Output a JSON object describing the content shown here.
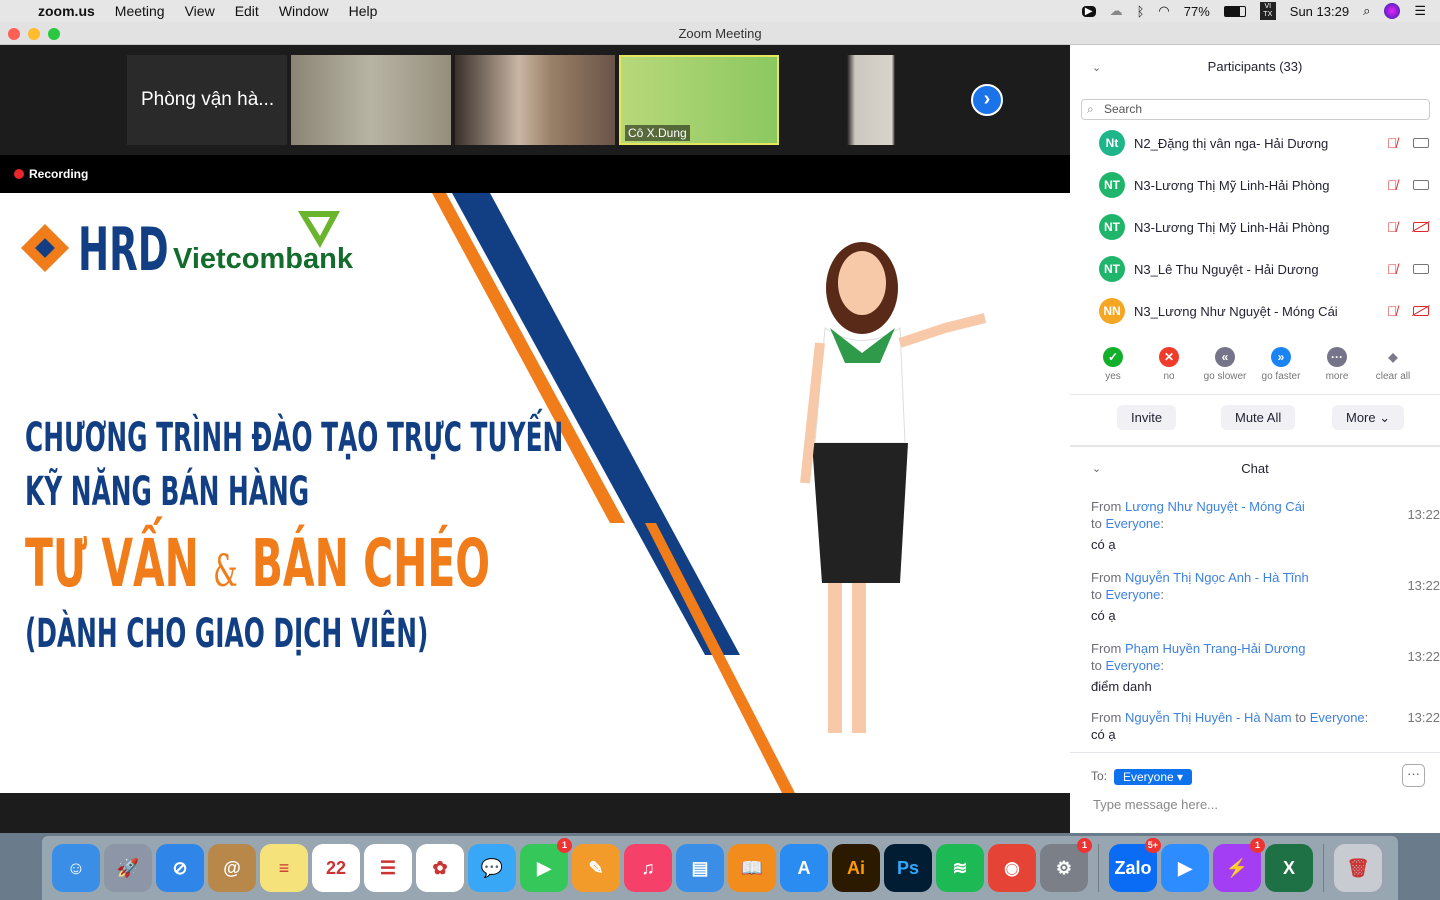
{
  "menubar": {
    "app": "zoom.us",
    "items": [
      "Meeting",
      "View",
      "Edit",
      "Window",
      "Help"
    ],
    "battery": "77%",
    "input": "VI TX",
    "clock": "Sun 13:29"
  },
  "window": {
    "title": "Zoom Meeting"
  },
  "thumbnails": {
    "first_label": "Phòng vận hà...",
    "active_name": "Cô X.Dung"
  },
  "recording": "Recording",
  "slide": {
    "logo_hrd": "HRD",
    "logo_bank": "Vietcombank",
    "line1": "CHƯƠNG TRÌNH ĐÀO TẠO TRỰC TUYẾN",
    "line2": "KỸ NĂNG BÁN HÀNG",
    "line3a": "TƯ VẤN",
    "amp": "&",
    "line3b": "BÁN CHÉO",
    "line4": "(DÀNH CHO GIAO DỊCH VIÊN)"
  },
  "participants": {
    "title": "Participants (33)",
    "search_placeholder": "Search",
    "list": [
      {
        "initials": "Nt",
        "name": "N2_Đặng thị vân nga- Hải Dương",
        "color": "#1fb58a",
        "video_off": false
      },
      {
        "initials": "NT",
        "name": "N3-Lương Thị Mỹ Linh-Hải Phòng",
        "color": "#1fb56a",
        "video_off": false
      },
      {
        "initials": "NT",
        "name": "N3-Lương Thị Mỹ Linh-Hải Phòng",
        "color": "#1fb56a",
        "video_off": true
      },
      {
        "initials": "NT",
        "name": "N3_Lê Thu Nguyệt - Hải Dương",
        "color": "#1fb56a",
        "video_off": false
      },
      {
        "initials": "NN",
        "name": "N3_Lương Như Nguyệt - Móng Cái",
        "color": "#f5a623",
        "video_off": true
      }
    ],
    "reactions": [
      {
        "label": "yes",
        "glyph": "✓",
        "color": "#12b02a"
      },
      {
        "label": "no",
        "glyph": "✕",
        "color": "#f03a2a"
      },
      {
        "label": "go slower",
        "glyph": "«",
        "color": "#76748a"
      },
      {
        "label": "go faster",
        "glyph": "»",
        "color": "#1a84f5"
      },
      {
        "label": "more",
        "glyph": "···",
        "color": "#76748a"
      },
      {
        "label": "clear all",
        "glyph": "◆",
        "color": "#7a7a8a"
      }
    ],
    "invite": "Invite",
    "mute_all": "Mute All",
    "more": "More ⌄"
  },
  "chat": {
    "title": "Chat",
    "messages": [
      {
        "from": "Lương Như Nguyệt - Móng Cái",
        "to": "Everyone",
        "time": "13:22",
        "text": "có ạ"
      },
      {
        "from": "Nguyễn Thị Ngọc Anh -  Hà Tĩnh",
        "to": "Everyone",
        "time": "13:22",
        "text": "có ạ"
      },
      {
        "from": "Phạm Huyền Trang-Hải Dương",
        "to": "Everyone",
        "time": "13:22",
        "text": "điểm danh"
      },
      {
        "from": "Nguyễn Thị Huyên - Hà Nam",
        "to": "Everyone",
        "time": "13:22",
        "text": "có ạ"
      }
    ],
    "from_word": "From",
    "to_word": "to",
    "to_label": "To:",
    "recipient": "Everyone ▾",
    "placeholder": "Type message here..."
  },
  "dock": [
    {
      "name": "Finder",
      "label": "☺",
      "color": "#3a8ee6"
    },
    {
      "name": "Launchpad",
      "label": "🚀",
      "color": "#8c96a6"
    },
    {
      "name": "Safari",
      "label": "⊘",
      "color": "#2f86e8"
    },
    {
      "name": "Contacts",
      "label": "@",
      "color": "#b8874a"
    },
    {
      "name": "Notes",
      "label": "≡",
      "color": "#f6e27a"
    },
    {
      "name": "Calendar",
      "label": "22",
      "color": "#ffffff"
    },
    {
      "name": "Reminders",
      "label": "☰",
      "color": "#ffffff"
    },
    {
      "name": "Photos",
      "label": "✿",
      "color": "#ffffff"
    },
    {
      "name": "Messages",
      "label": "💬",
      "color": "#38a7f5"
    },
    {
      "name": "FaceTime",
      "label": "▶",
      "color": "#35c759",
      "badge": "1"
    },
    {
      "name": "Pages",
      "label": "✎",
      "color": "#f29b2b"
    },
    {
      "name": "Music",
      "label": "♫",
      "color": "#f5406a"
    },
    {
      "name": "Keynote",
      "label": "▤",
      "color": "#3a8ee6"
    },
    {
      "name": "Books",
      "label": "📖",
      "color": "#f28c1c"
    },
    {
      "name": "App Store",
      "label": "A",
      "color": "#2a8cf0"
    },
    {
      "name": "Illustrator",
      "label": "Ai",
      "color": "#2b1a00"
    },
    {
      "name": "Photoshop",
      "label": "Ps",
      "color": "#001d34"
    },
    {
      "name": "Spotify",
      "label": "≋",
      "color": "#1db954"
    },
    {
      "name": "Chrome",
      "label": "◉",
      "color": "#e54335"
    },
    {
      "name": "System Preferences",
      "label": "⚙",
      "color": "#7a7f88",
      "badge": "1"
    },
    {
      "name": "Zalo",
      "label": "Zalo",
      "color": "#0a6cf5",
      "badge": "5+"
    },
    {
      "name": "Zoom",
      "label": "▶",
      "color": "#2d8cff"
    },
    {
      "name": "Messenger",
      "label": "⚡",
      "color": "#a33ef5",
      "badge": "1"
    },
    {
      "name": "Excel",
      "label": "X",
      "color": "#1e7145"
    },
    {
      "name": "Trash",
      "label": "🗑",
      "color": "#c8ccd2"
    }
  ]
}
